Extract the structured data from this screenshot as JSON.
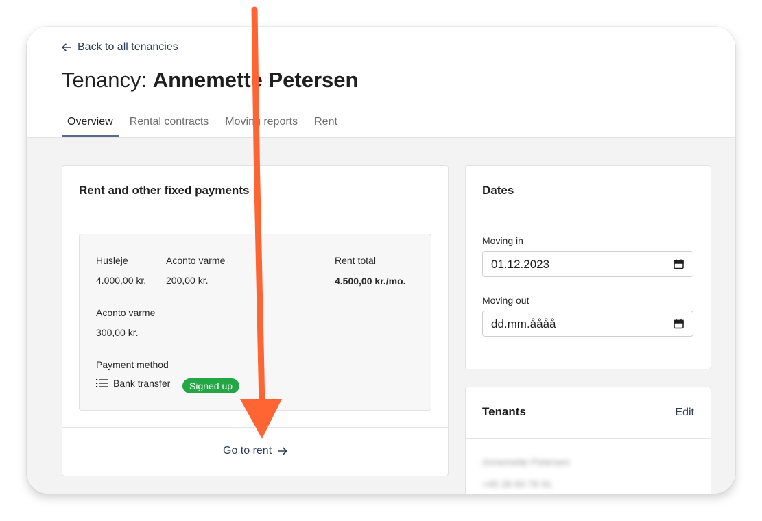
{
  "header": {
    "back_label": "Back to all tenancies",
    "title_prefix": "Tenancy: ",
    "title_name": "Annemette Petersen"
  },
  "tabs": [
    {
      "label": "Overview",
      "active": true
    },
    {
      "label": "Rental contracts",
      "active": false
    },
    {
      "label": "Moving reports",
      "active": false
    },
    {
      "label": "Rent",
      "active": false
    }
  ],
  "rent_card": {
    "title": "Rent and other fixed payments",
    "items": [
      {
        "label": "Husleje",
        "value": "4.000,00 kr."
      },
      {
        "label": "Aconto varme",
        "value": "200,00 kr."
      },
      {
        "label": "Aconto varme",
        "value": "300,00 kr."
      }
    ],
    "rent_total_label": "Rent total",
    "rent_total_value": "4.500,00 kr./mo.",
    "payment_method_label": "Payment method",
    "payment_method_icon": "list-icon",
    "payment_method_value": "Bank transfer",
    "status_badge": "Signed up",
    "go_to_rent": "Go to rent"
  },
  "dates_card": {
    "title": "Dates",
    "moving_in_label": "Moving in",
    "moving_in_value": "01.12.2023",
    "moving_out_label": "Moving out",
    "moving_out_placeholder": "dd.mm.åååå"
  },
  "tenants_card": {
    "title": "Tenants",
    "edit_label": "Edit",
    "tenant_name": "Annemette Petersen",
    "tenant_phone": "+45 28 83 78 91"
  },
  "colors": {
    "annotation_arrow": "#ff6433",
    "badge_green": "#22a744",
    "link_blue": "#2f3e5c"
  }
}
